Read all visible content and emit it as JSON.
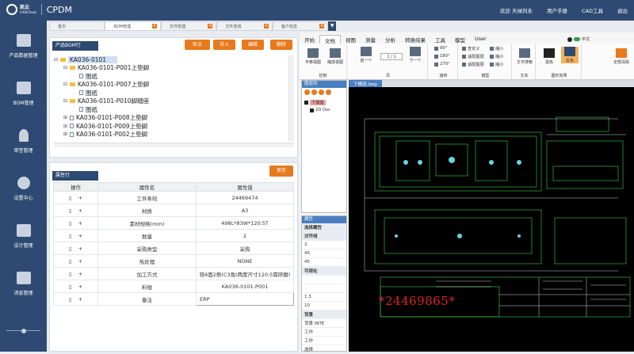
{
  "header": {
    "logo_text": "凯云",
    "logo_sub": "CASICloud",
    "app_name": "CPDM",
    "welcome": "欢迎 天禄刘永",
    "links": [
      "用户手册",
      "CAD工具",
      "退出"
    ]
  },
  "sidebar": {
    "items": [
      {
        "label": "产品数据管理",
        "icon": "image-icon"
      },
      {
        "label": "BOM管理",
        "icon": "image-icon"
      },
      {
        "label": "审签管理",
        "icon": "stamp-icon"
      },
      {
        "label": "设置中心",
        "icon": "gear-icon"
      },
      {
        "label": "设计管理",
        "icon": "image-icon"
      },
      {
        "label": "消息管理",
        "icon": "image-icon"
      }
    ]
  },
  "tabs": [
    {
      "label": "首页",
      "active": false
    },
    {
      "label": "BOM管理",
      "active": true
    },
    {
      "label": "文件管理",
      "active": false
    },
    {
      "label": "文件查阅",
      "active": false
    },
    {
      "label": "客户信息",
      "active": false
    }
  ],
  "bom": {
    "panel_title": "产品BOM行",
    "buttons": [
      "检点",
      "导入",
      "编辑",
      "删除"
    ],
    "tree": [
      {
        "text": "KA036-0101",
        "type": "folder",
        "level": 0,
        "toggle": "⊟",
        "selected": true
      },
      {
        "text": "KA036-0101-P001上垫脚",
        "type": "folder",
        "level": 1,
        "toggle": "⊟"
      },
      {
        "text": "图纸",
        "type": "file",
        "level": 2,
        "toggle": ""
      },
      {
        "text": "KA036-0101-P007上垫脚",
        "type": "folder",
        "level": 1,
        "toggle": "⊟"
      },
      {
        "text": "图纸",
        "type": "file",
        "level": 2,
        "toggle": ""
      },
      {
        "text": "KA036-0101-P010脚踏座",
        "type": "folder",
        "level": 1,
        "toggle": "⊟"
      },
      {
        "text": "图纸",
        "type": "file",
        "level": 2,
        "toggle": ""
      },
      {
        "text": "KA036-0101-P008上垫脚",
        "type": "file",
        "level": 1,
        "toggle": "⊞"
      },
      {
        "text": "KA036-0101-P009上垫脚",
        "type": "file",
        "level": 1,
        "toggle": "⊞"
      },
      {
        "text": "KA036-0101-P002上垫脚",
        "type": "file",
        "level": 1,
        "toggle": "⊞"
      }
    ]
  },
  "attrs": {
    "panel_title": "属性行",
    "save_label": "保存",
    "columns": [
      "操作",
      "属性名",
      "属性值"
    ],
    "rows": [
      {
        "name": "工件条码",
        "value": "24469474"
      },
      {
        "name": "材质",
        "value": "A3"
      },
      {
        "name": "素材规格(mm)",
        "value": "498L*83W*120.5T"
      },
      {
        "name": "数量",
        "value": "2"
      },
      {
        "name": "采购类型",
        "value": "采购"
      },
      {
        "name": "热处理",
        "value": "NONE"
      },
      {
        "name": "加工方式",
        "value": "铣6面2侧(C3角(两度尺寸120.5需研磨)"
      },
      {
        "name": "料號",
        "value": "KA036-0101-P001"
      },
      {
        "name": "备注",
        "value": "ERP"
      }
    ]
  },
  "cad": {
    "ribbon_tabs": [
      "开始",
      "文档",
      "视图",
      "测量",
      "分析",
      "转换结果",
      "工具",
      "模型",
      "User"
    ],
    "active_tab": "文档",
    "groups": [
      {
        "label": "控制",
        "buttons": [
          "平移视图",
          "缩放视图"
        ]
      },
      {
        "label": "页",
        "buttons": [
          "前一个",
          "下一个"
        ],
        "page": "1 / 1"
      },
      {
        "label": "旋转",
        "items": [
          "90°",
          "180°",
          "270°"
        ]
      },
      {
        "label": "模型",
        "items": [
          "查定义",
          "适配图层",
          "适配图层",
          "缩小",
          "缩小",
          "缩小"
        ]
      },
      {
        "label": "文本",
        "buttons": [
          "文字搜索"
        ]
      },
      {
        "label": "图形效果",
        "buttons": [
          "黑色",
          "反色"
        ]
      },
      {
        "label": "",
        "buttons": [
          "全部清除"
        ]
      }
    ],
    "lang": "中文",
    "layers_title": "图层列",
    "layer_items": [
      "下模座",
      "2D Doc"
    ],
    "drawing_tab": "下模座.dwg",
    "props_title": "属性",
    "props_rows": [
      {
        "text": "选择属性",
        "hdr": true
      },
      {
        "text": "对齐线",
        "hdr": true
      },
      {
        "text": "2",
        "hdr": false
      },
      {
        "text": "45",
        "hdr": false
      },
      {
        "text": "45",
        "hdr": false
      },
      {
        "text": "可视化",
        "hdr": true
      },
      {
        "text": "",
        "hdr": false
      },
      {
        "text": "",
        "hdr": false
      },
      {
        "text": "1.3",
        "hdr": false
      },
      {
        "text": "10",
        "hdr": false
      },
      {
        "text": "背景",
        "hdr": true
      },
      {
        "text": "背景 INTE",
        "hdr": false
      },
      {
        "text": "工作",
        "hdr": false
      },
      {
        "text": "工作",
        "hdr": false
      },
      {
        "text": "选择",
        "hdr": false
      }
    ],
    "barcode_text": "*24469865*"
  }
}
